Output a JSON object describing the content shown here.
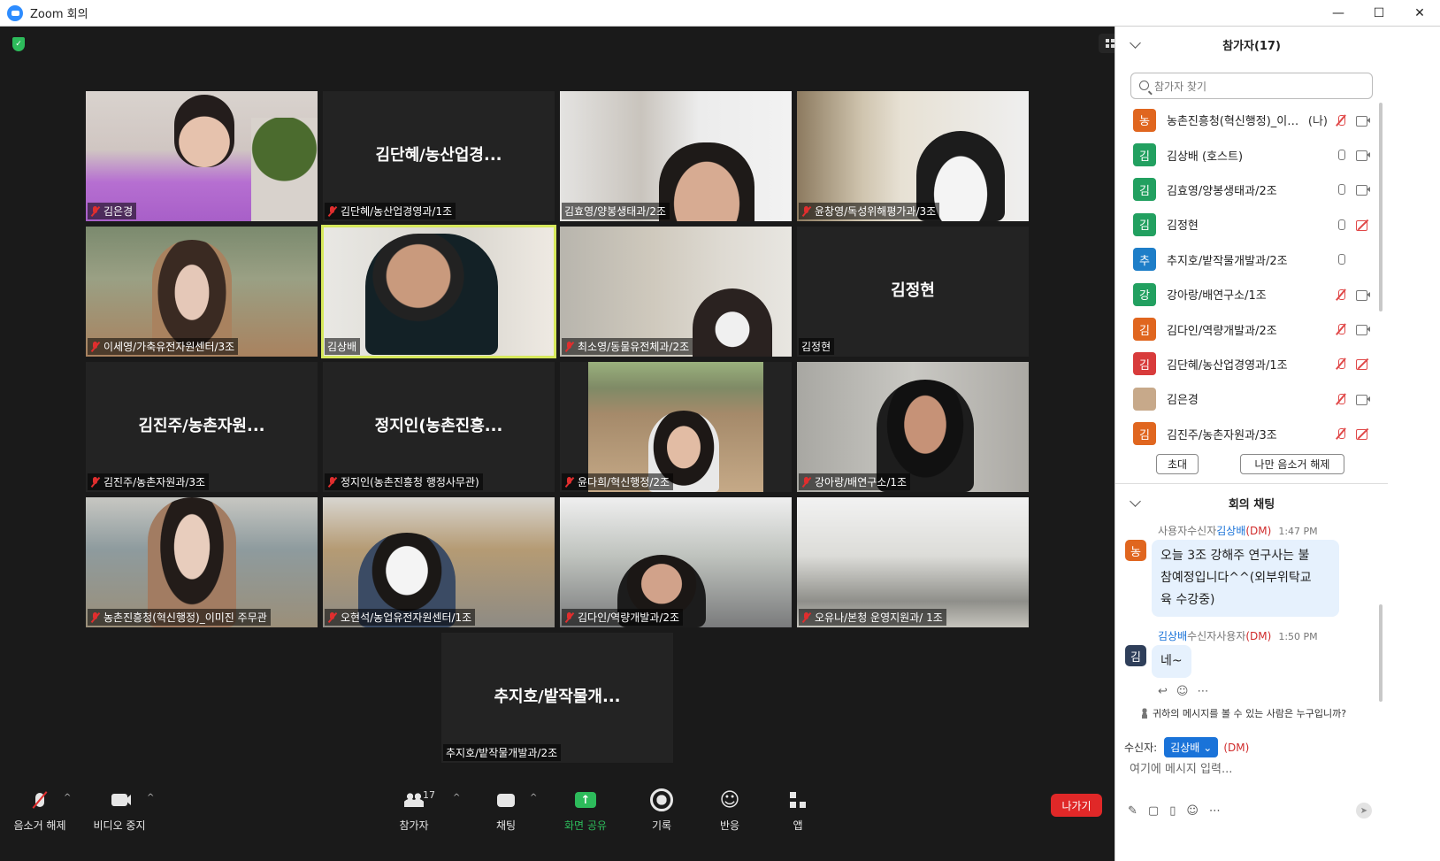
{
  "window": {
    "title": "Zoom 회의",
    "minimize": "—",
    "maximize": "☐",
    "close": "✕"
  },
  "video": {
    "view_label": "보기",
    "tiles": [
      {
        "caption": "김은경",
        "big_name": "",
        "muted": true
      },
      {
        "caption": "김단혜/농산업경영과/1조",
        "big_name": "김단혜/농산업경...",
        "muted": true
      },
      {
        "caption": "김효영/양봉생태과/2조",
        "big_name": "",
        "muted": false
      },
      {
        "caption": "윤창영/독성위해평가과/3조",
        "big_name": "",
        "muted": true
      },
      {
        "caption": "이세영/가축유전자원센터/3조",
        "big_name": "",
        "muted": true
      },
      {
        "caption": "김상배",
        "big_name": "",
        "muted": false
      },
      {
        "caption": "최소영/동물유전체과/2조",
        "big_name": "",
        "muted": true
      },
      {
        "caption": "김정현",
        "big_name": "김정현",
        "muted": false
      },
      {
        "caption": "김진주/농촌자원과/3조",
        "big_name": "김진주/농촌자원...",
        "muted": true
      },
      {
        "caption": "정지인(농촌진흥청 행정사무관)",
        "big_name": "정지인(농촌진흥...",
        "muted": true
      },
      {
        "caption": "윤다희/혁신행정/2조",
        "big_name": "",
        "muted": true
      },
      {
        "caption": "강아랑/배연구소/1조",
        "big_name": "",
        "muted": true
      },
      {
        "caption": "농촌진흥청(혁신행정)_이미진 주무관",
        "big_name": "",
        "muted": true
      },
      {
        "caption": "오현석/농업유전자원센터/1조",
        "big_name": "",
        "muted": true
      },
      {
        "caption": "김다인/역량개발과/2조",
        "big_name": "",
        "muted": true
      },
      {
        "caption": "오유나/본청 운영지원과/ 1조",
        "big_name": "",
        "muted": true
      },
      {
        "caption": "추지호/밭작물개발과/2조",
        "big_name": "추지호/밭작물개...",
        "muted": false
      }
    ]
  },
  "toolbar": {
    "unmute": "음소거 해제",
    "stop_video": "비디오 중지",
    "participants": "참가자",
    "participants_count": "17",
    "chat": "채팅",
    "share": "화면 공유",
    "record": "기록",
    "reactions": "반응",
    "apps": "앱",
    "leave": "나가기"
  },
  "participants_panel": {
    "title": "참가자(17)",
    "search_placeholder": "참가자 찾기",
    "invite": "초대",
    "unmute_me": "나만 음소거 해제",
    "items": [
      {
        "initial": "농",
        "name": "농촌진흥청(혁신행정)_이미...",
        "tag": "(나)",
        "color": "#e0661f",
        "mic": "off",
        "cam": "on"
      },
      {
        "initial": "김",
        "name": "김상배 (호스트)",
        "tag": "",
        "color": "#22a060",
        "mic": "on",
        "cam": "on"
      },
      {
        "initial": "김",
        "name": "김효영/양봉생태과/2조",
        "tag": "",
        "color": "#22a060",
        "mic": "on",
        "cam": "on"
      },
      {
        "initial": "김",
        "name": "김정현",
        "tag": "",
        "color": "#22a060",
        "mic": "on",
        "cam": "off"
      },
      {
        "initial": "추",
        "name": "추지호/밭작물개발과/2조",
        "tag": "",
        "color": "#1e7ec8",
        "mic": "on",
        "cam": "none"
      },
      {
        "initial": "강",
        "name": "강아랑/배연구소/1조",
        "tag": "",
        "color": "#22a060",
        "mic": "off",
        "cam": "on"
      },
      {
        "initial": "김",
        "name": "김다인/역량개발과/2조",
        "tag": "",
        "color": "#e0661f",
        "mic": "off",
        "cam": "on"
      },
      {
        "initial": "김",
        "name": "김단혜/농산업경영과/1조",
        "tag": "",
        "color": "#d83b3b",
        "mic": "off",
        "cam": "off"
      },
      {
        "initial": "",
        "name": "김은경",
        "tag": "",
        "color": "#c7a98a",
        "mic": "off",
        "cam": "on"
      },
      {
        "initial": "김",
        "name": "김진주/농촌자원과/3조",
        "tag": "",
        "color": "#e0661f",
        "mic": "off",
        "cam": "off"
      }
    ]
  },
  "chat": {
    "title": "회의 채팅",
    "messages": [
      {
        "avatar": "농",
        "avatar_color": "#e0661f",
        "from": "사용자",
        "to_label": "수신자",
        "to": "김상배",
        "dm": "(DM)",
        "time": "1:47 PM",
        "lines": [
          "오늘 3조 강해주 연구사는 불",
          "참예정입니다^^(외부위탁교",
          "육 수강중)"
        ]
      },
      {
        "avatar": "김",
        "avatar_color": "#2f3f5a",
        "from": "김상배",
        "to_label": "수신자",
        "to": "사용자",
        "dm": "(DM)",
        "time": "1:50 PM",
        "lines": [
          "네~"
        ]
      }
    ],
    "who_can_see": "귀하의 메시지를 볼 수 있는 사람은 누구입니까?",
    "recipient_label": "수신자:",
    "recipient": "김상배",
    "recipient_dm": "(DM)",
    "input_placeholder": "여기에 메시지 입력..."
  }
}
